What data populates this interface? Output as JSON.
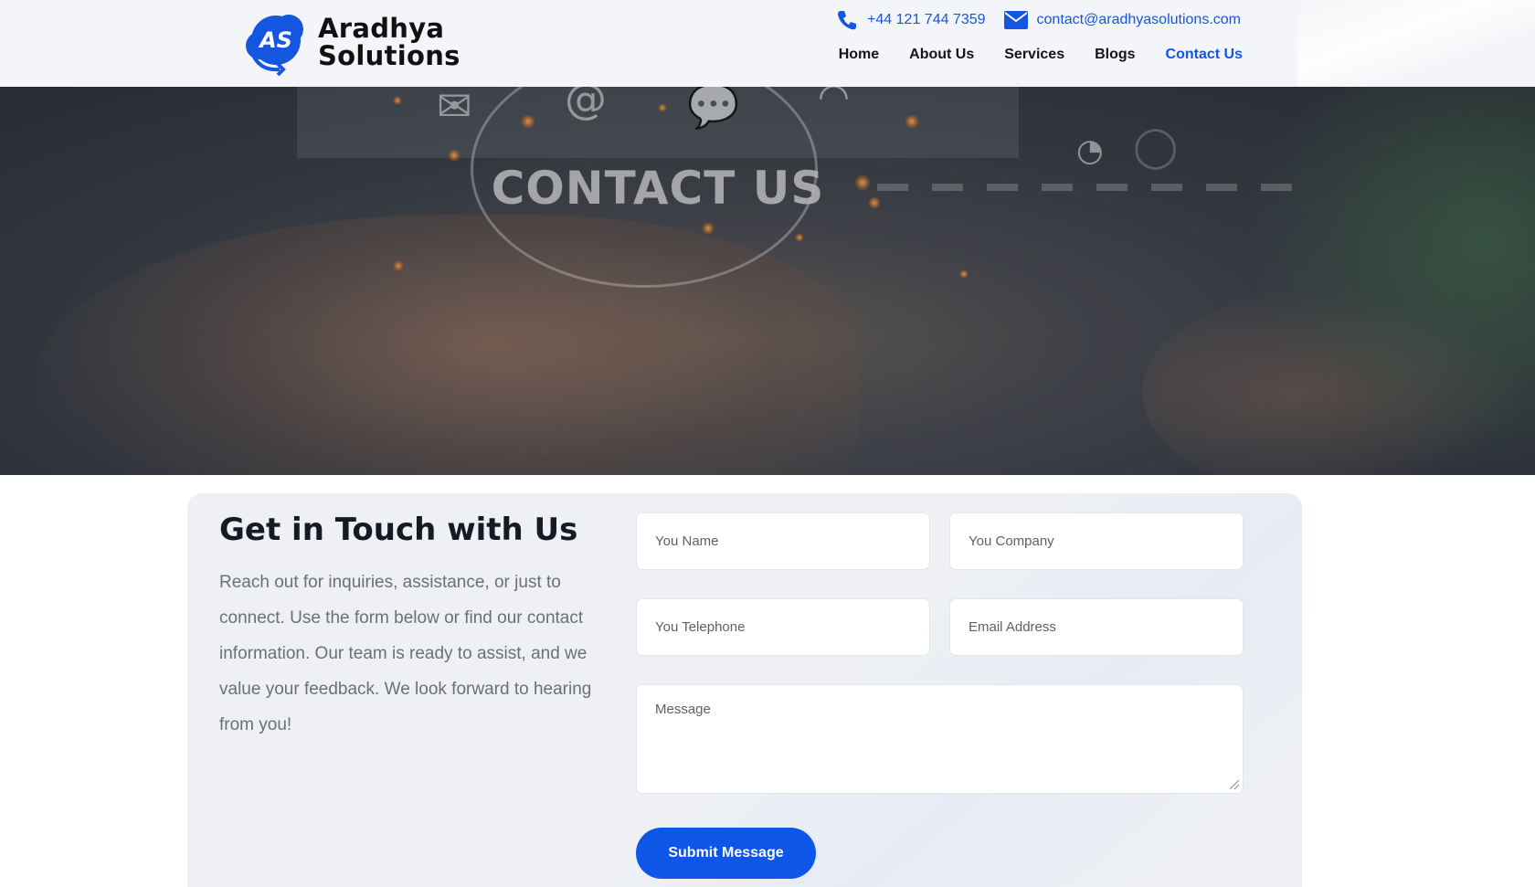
{
  "brand": {
    "line1": "Aradhya",
    "line2": "Solutions",
    "logo_monogram": "AS",
    "logo_icon": "cloud-logo-icon",
    "accent_color": "#1556e0"
  },
  "topbar": {
    "phone": "+44 121 744 7359",
    "phone_icon": "phone-icon",
    "email": "contact@aradhyasolutions.com",
    "email_icon": "envelope-icon"
  },
  "nav": {
    "items": [
      {
        "label": "Home"
      },
      {
        "label": "About Us"
      },
      {
        "label": "Services"
      },
      {
        "label": "Blogs"
      },
      {
        "label": "Contact Us",
        "active": true
      }
    ]
  },
  "hero": {
    "title": "CONTACT US"
  },
  "contact": {
    "heading": "Get in Touch with Us",
    "description": "Reach out for inquiries, assistance, or just to connect. Use the form below or find our contact information. Our team is ready to assist, and we value your feedback. We look forward to hearing from you!",
    "form": {
      "name_placeholder": "You Name",
      "company_placeholder": "You Company",
      "telephone_placeholder": "You Telephone",
      "email_placeholder": "Email Address",
      "message_placeholder": "Message",
      "submit_label": "Submit Message"
    }
  }
}
